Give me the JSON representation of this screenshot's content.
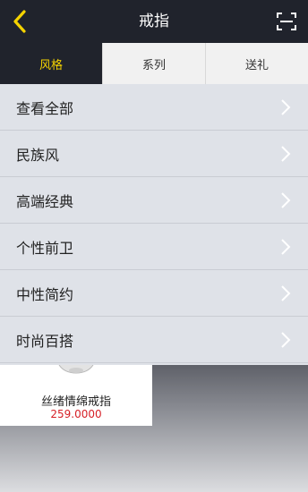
{
  "header": {
    "title": "戒指",
    "back_icon": "chevron-left-icon",
    "scan_icon": "scan-icon",
    "accent_color": "#f5d300"
  },
  "tabs": [
    {
      "label": "风格",
      "active": true
    },
    {
      "label": "系列",
      "active": false
    },
    {
      "label": "送礼",
      "active": false
    }
  ],
  "menu": {
    "items": [
      {
        "label": "查看全部"
      },
      {
        "label": "民族风"
      },
      {
        "label": "高端经典"
      },
      {
        "label": "个性前卫"
      },
      {
        "label": "中性简约"
      },
      {
        "label": "时尚百搭"
      }
    ]
  },
  "product": {
    "name": "丝绪情绵戒指",
    "price": "259.0000",
    "price_color": "#d61f26"
  }
}
